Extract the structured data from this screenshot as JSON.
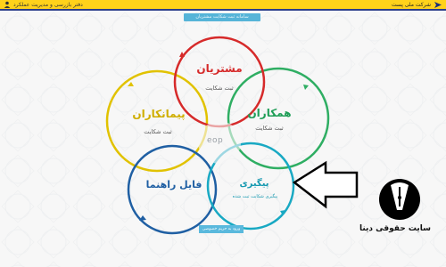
{
  "header": {
    "brand_label": "شرکت ملی پست",
    "office_label": "دفتر بازرسی و مدیریت عملکرد"
  },
  "banner": {
    "text": "سامانه ثبت شکایت مشتریان"
  },
  "petals": {
    "customers": {
      "title": "مشتریان",
      "subtitle": "ثبت شکایت",
      "color": "#d62a2a"
    },
    "colleagues": {
      "title": "همکاران",
      "subtitle": "ثبت شکایت",
      "color": "#1f9e57"
    },
    "contractors": {
      "title": "پیمانکاران",
      "subtitle": "ثبت شکایت",
      "color": "#e1c200"
    },
    "guide": {
      "title": "فایل راهنما",
      "subtitle": "",
      "color": "#1f5fa3"
    },
    "followup": {
      "title": "پیگیری",
      "subtitle": "پیگیری شکایت ثبت شده",
      "color": "#1699b0"
    }
  },
  "center_mark": "eop",
  "bottom_button": {
    "label": "ورود به حریم خصوصی"
  },
  "watermark": {
    "text": "سایت حقوقی دینا"
  }
}
